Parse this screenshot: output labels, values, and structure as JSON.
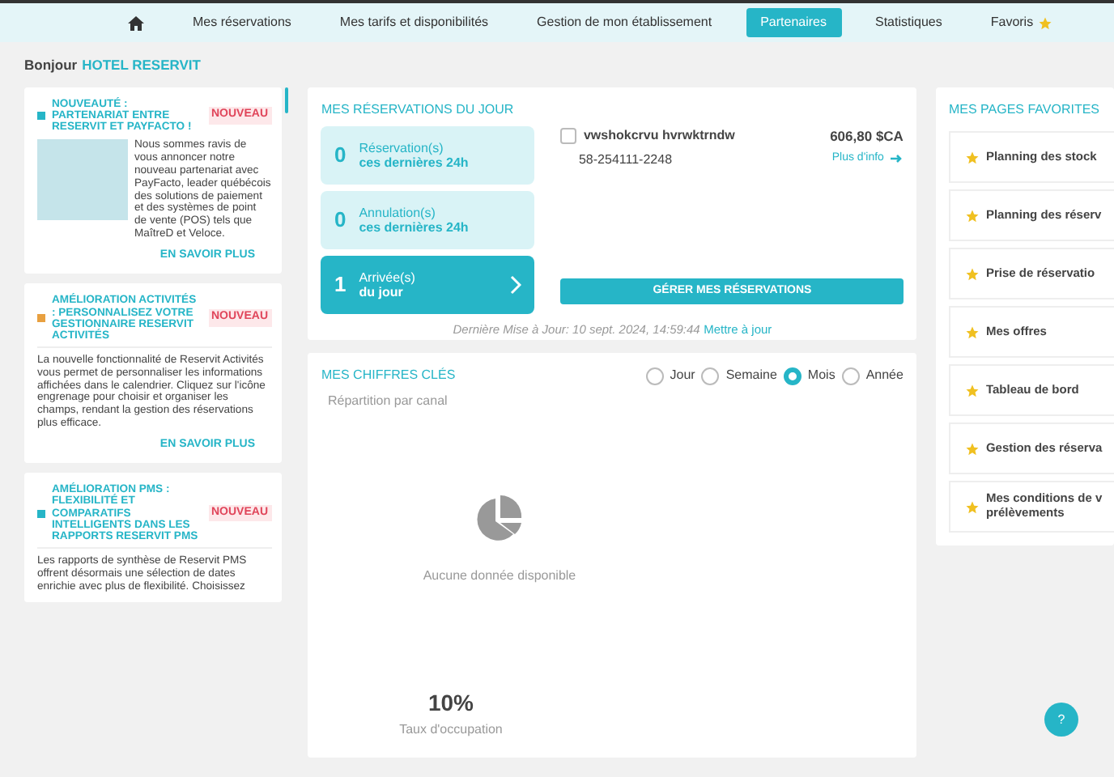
{
  "nav": {
    "items": [
      {
        "kind": "home",
        "selected": false
      },
      {
        "kind": "text",
        "label": "Mes réservations",
        "selected": false
      },
      {
        "kind": "text",
        "label": "Mes tarifs et disponibilités",
        "selected": false
      },
      {
        "kind": "text",
        "label": "Gestion de mon établissement",
        "selected": false
      },
      {
        "kind": "text",
        "label": "Partenaires",
        "selected": true
      },
      {
        "kind": "text",
        "label": "Statistiques",
        "selected": false
      },
      {
        "kind": "favorites",
        "label": "Favoris",
        "selected": false
      }
    ]
  },
  "greeting": {
    "prefix": "Bonjour",
    "hotel": "HOTEL RESERVIT"
  },
  "news": [
    {
      "title": "NOUVEAUTÉ : PARTENARIAT ENTRE RESERVIT ET PAYFACTO !",
      "color": "#26b5c7",
      "badge": "NOUVEAU",
      "image": true,
      "body": "Nous sommes ravis de vous annoncer notre nouveau partenariat avec PayFacto, leader québécois des solutions de paiement et des systèmes de point de vente (POS) tels que MaîtreD et Veloce.",
      "link": "EN SAVOIR PLUS"
    },
    {
      "title": "AMÉLIORATION ACTIVITÉS : PERSONNALISEZ VOTRE GESTIONNAIRE RESERVIT ACTIVITÉS",
      "color": "#e8a040",
      "badge": "NOUVEAU",
      "image": false,
      "body": "La nouvelle fonctionnalité de Reservit Activités vous permet de personnaliser les informations affichées dans le calendrier. Cliquez sur l'icône engrenage pour choisir et organiser les champs, rendant la gestion des réservations plus efficace.",
      "link": "EN SAVOIR PLUS"
    },
    {
      "title": "AMÉLIORATION PMS : FLEXIBILITÉ ET COMPARATIFS INTELLIGENTS DANS LES RAPPORTS RESERVIT PMS",
      "color": "#26b5c7",
      "badge": "NOUVEAU",
      "image": false,
      "body": "Les rapports de synthèse de Reservit PMS offrent désormais une sélection de dates enrichie avec plus de flexibilité. Choisissez"
    }
  ],
  "today": {
    "title": "MES RÉSERVATIONS DU JOUR",
    "tiles": [
      {
        "count": "0",
        "label": "Réservation(s)",
        "sub": "ces dernières 24h",
        "selected": false
      },
      {
        "count": "0",
        "label": "Annulation(s)",
        "sub": "ces dernières 24h",
        "selected": false
      },
      {
        "count": "1",
        "label": "Arrivée(s)",
        "sub": "du jour",
        "selected": true
      }
    ],
    "bookings": [
      {
        "name": "vwshokcrvu hvrwktrndw",
        "ref": "58-254111-2248",
        "amount": "606,80 $CA",
        "link": "Plus d'info",
        "checked": false
      }
    ],
    "manage": "GÉRER MES RÉSERVATIONS",
    "updated": "Dernière Mise à Jour: 10 sept. 2024, 14:59:44",
    "refresh": "Mettre à jour"
  },
  "key_figures": {
    "title": "MES CHIFFRES CLÉS",
    "periods": [
      {
        "label": "Jour",
        "selected": false
      },
      {
        "label": "Semaine",
        "selected": false
      },
      {
        "label": "Mois",
        "selected": true
      },
      {
        "label": "Année",
        "selected": false
      }
    ],
    "channel_title": "Répartition par canal",
    "empty": "Aucune donnée disponible",
    "occupancy": "10%",
    "occupancy_label": "Taux d'occupation"
  },
  "favorites": {
    "title": "MES PAGES FAVORITES",
    "items": [
      "Planning des stock",
      "Planning des réserv",
      "Prise de réservatio",
      "Mes offres",
      "Tableau de bord",
      "Gestion des réserva",
      "Mes conditions de v\nprélèvements"
    ]
  },
  "help": "?"
}
